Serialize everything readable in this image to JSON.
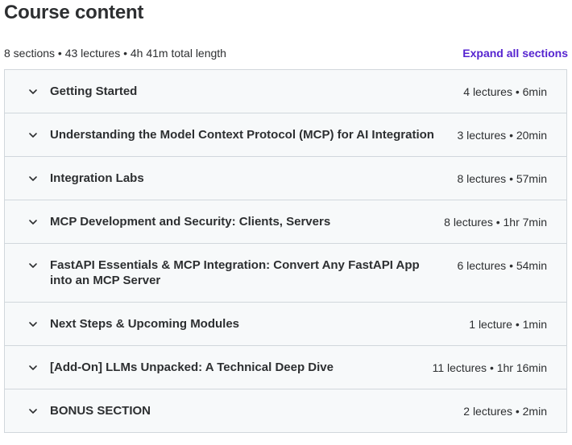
{
  "header": {
    "title": "Course content"
  },
  "summary": {
    "text": "8 sections • 43 lectures • 4h 41m total length",
    "expand_all_label": "Expand all sections"
  },
  "sections": [
    {
      "title": "Getting Started",
      "meta": "4 lectures • 6min"
    },
    {
      "title": "Understanding the Model Context Protocol (MCP) for AI Integration",
      "meta": "3 lectures • 20min"
    },
    {
      "title": "Integration Labs",
      "meta": "8 lectures • 57min"
    },
    {
      "title": "MCP Development and Security: Clients, Servers",
      "meta": "8 lectures • 1hr 7min"
    },
    {
      "title": "FastAPI Essentials & MCP Integration: Convert Any FastAPI App into an MCP Server",
      "meta": "6 lectures • 54min"
    },
    {
      "title": "Next Steps & Upcoming Modules",
      "meta": "1 lecture • 1min"
    },
    {
      "title": "[Add-On] LLMs Unpacked: A Technical Deep Dive",
      "meta": "11 lectures • 1hr 16min"
    },
    {
      "title": "BONUS SECTION",
      "meta": "2 lectures • 2min"
    }
  ],
  "icons": {
    "section_toggle": "chevron-down-icon"
  },
  "colors": {
    "accent": "#5624d0",
    "text": "#2d2f31",
    "section_bg": "#f7f9fa",
    "border": "#d1d7dc"
  }
}
